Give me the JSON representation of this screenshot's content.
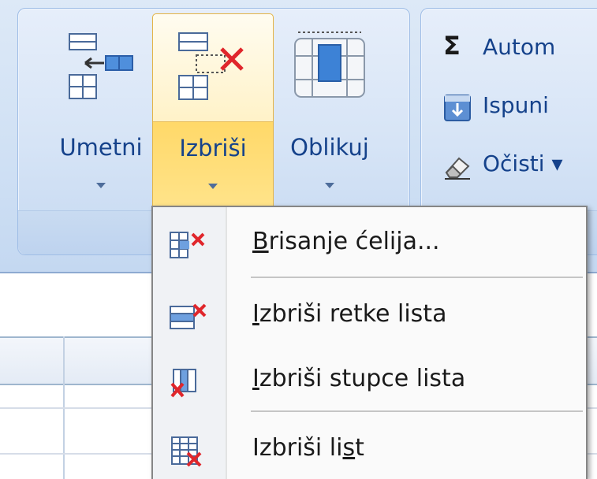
{
  "ribbon": {
    "cells_group": {
      "insert_label": "Umetni",
      "delete_label": "Izbriši",
      "format_label": "Oblikuj"
    },
    "editing_group": {
      "autosum_symbol": "Σ",
      "autosum_label": "Autom",
      "fill_label": "Ispuni",
      "clear_label": "Očisti",
      "clear_suffix": "▾"
    }
  },
  "menu": {
    "items": [
      {
        "accel": "B",
        "rest": "risanje ćelija...",
        "icon": "delete-cells-icon"
      },
      {
        "accel": "I",
        "rest": "zbriši retke lista",
        "icon": "delete-rows-icon"
      },
      {
        "accel": "I",
        "rest": "zbriši stupce lista",
        "icon": "delete-columns-icon"
      },
      {
        "pre": "Izbriši li",
        "accel": "s",
        "rest": "t",
        "icon": "delete-sheet-icon"
      }
    ]
  },
  "colors": {
    "ribbon_text": "#15428b",
    "highlight": "#ffd867",
    "delete_x": "#e0262b"
  }
}
